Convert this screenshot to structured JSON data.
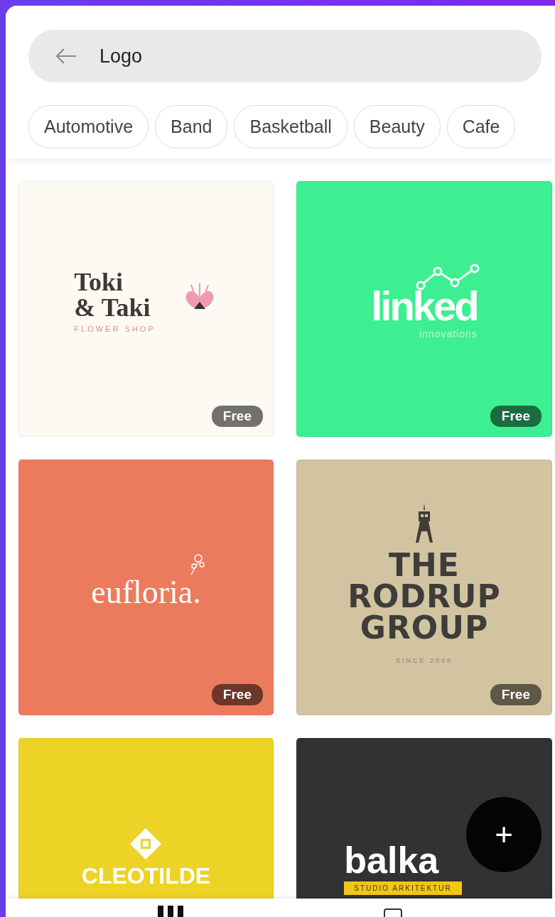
{
  "search": {
    "value": "Logo"
  },
  "categories": [
    {
      "label": "Automotive"
    },
    {
      "label": "Band"
    },
    {
      "label": "Basketball"
    },
    {
      "label": "Beauty"
    },
    {
      "label": "Cafe"
    }
  ],
  "templates": [
    {
      "kind": "toki",
      "color": "#fdfaf4",
      "lines": [
        "Toki",
        "& Taki"
      ],
      "tagline": "FLOWER SHOP",
      "badge": "Free"
    },
    {
      "kind": "linked",
      "color": "#3def90",
      "lines": [
        "linked"
      ],
      "tagline": "innovations",
      "badge": "Free"
    },
    {
      "kind": "eufloria",
      "color": "#ec7b5d",
      "lines": [
        "eufloria."
      ],
      "badge": "Free"
    },
    {
      "kind": "rodrup",
      "color": "#d3c4a1",
      "lines": [
        "THE",
        "RODRUP",
        "GROUP"
      ],
      "tagline": "SINCE 2006",
      "badge": "Free"
    },
    {
      "kind": "cleotilde",
      "color": "#ecd325",
      "lines": [
        "CLEOTILDE"
      ]
    },
    {
      "kind": "balkan",
      "color": "#323234",
      "lines": [
        "balka"
      ],
      "tagline": "STUDIO ARKITEKTUR"
    }
  ],
  "fab": {
    "label": "+"
  }
}
